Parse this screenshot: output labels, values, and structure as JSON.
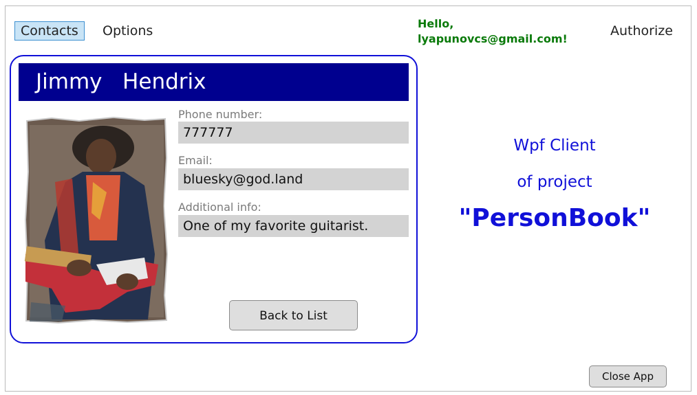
{
  "menu": {
    "contacts": "Contacts",
    "options": "Options",
    "authorize": "Authorize"
  },
  "greeting": {
    "line1": "Hello,",
    "line2": "lyapunovcs@gmail.com!"
  },
  "contact": {
    "name": "Jimmy   Hendrix",
    "photo": "guitarist-photo",
    "fields": [
      {
        "label": "Phone number:",
        "value": "777777"
      },
      {
        "label": "Email:",
        "value": "bluesky@god.land"
      },
      {
        "label": "Additional info:",
        "value": "One of my favorite guitarist."
      }
    ],
    "back_button": "Back to List"
  },
  "about": {
    "line1": "Wpf Client",
    "line2": "of project",
    "line3": "\"PersonBook\""
  },
  "footer": {
    "close_button": "Close App"
  },
  "colors": {
    "accent_blue": "#1010d8",
    "name_bar_bg": "#00008f",
    "greeting_green": "#0a7a0a",
    "field_bg": "#d3d3d3"
  }
}
